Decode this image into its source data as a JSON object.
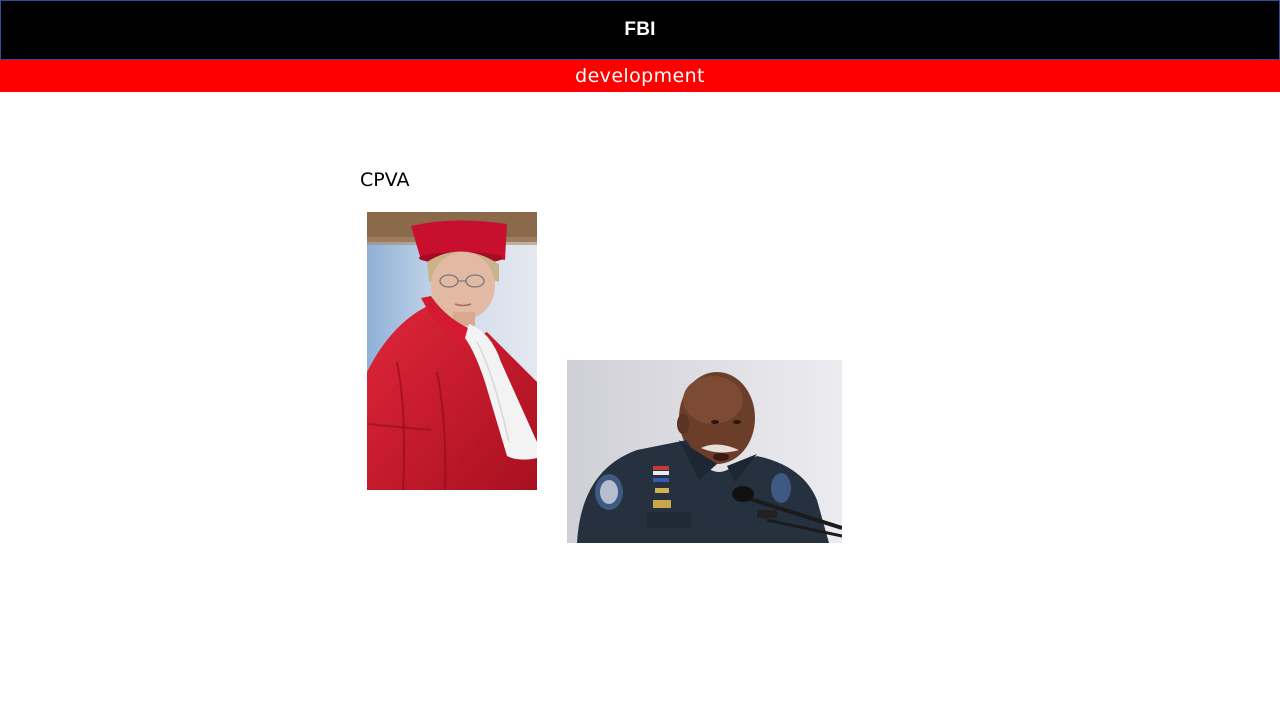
{
  "header": {
    "title": "FBI"
  },
  "banner": {
    "text": "development"
  },
  "main": {
    "heading": "CPVA",
    "photos": [
      {
        "description_icon": "judge-portrait-image"
      },
      {
        "description_icon": "police-officer-speaking-image"
      }
    ]
  },
  "colors": {
    "header_bg": "#000000",
    "banner_bg": "#ff0000",
    "page_bg": "#ffffff"
  }
}
